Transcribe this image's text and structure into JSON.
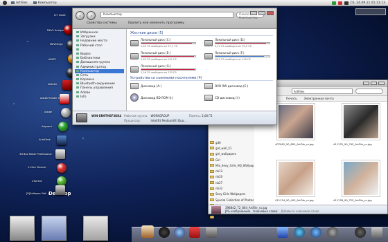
{
  "menubar": {
    "items": [
      "ArtFiles",
      "Компьютер"
    ],
    "clock": "Сб, 24.09.11 01:11:13"
  },
  "desktop_labels": [
    "ICT mode",
    "MKV1 Analyzer",
    "MKVMerge",
    "AIMP2",
    "AIDA64",
    "Adobe Reader X",
    "Adobe",
    "Adguard",
    "AutoDesk",
    "3D Box Maker Professional",
    "1-Click Cleaner",
    "uTorrent",
    "[R]Software Edit.",
    "Desktop"
  ],
  "computer_window": {
    "address": "Компьютер",
    "search_placeholder": "Поиск: Компьютер",
    "toolbar": [
      "Свойства системы",
      "Удалить или изменить программу"
    ],
    "nav": [
      {
        "label": "Избранное",
        "selected": false
      },
      {
        "label": "Загрузки",
        "selected": false
      },
      {
        "label": "Недавние места",
        "selected": false
      },
      {
        "label": "Рабочий стол",
        "selected": false
      },
      {
        "label": "",
        "selected": false
      },
      {
        "label": "Видео",
        "selected": false
      },
      {
        "label": "Библиотеки",
        "selected": false
      },
      {
        "label": "Домашняя группа",
        "selected": false
      },
      {
        "label": "Администратор",
        "selected": false
      },
      {
        "label": "Компьютер",
        "selected": true
      },
      {
        "label": "Сеть",
        "selected": false
      },
      {
        "label": "Корзина",
        "selected": false
      },
      {
        "label": "Bluetooth-окружение",
        "selected": false
      },
      {
        "label": "Панель управления",
        "selected": false
      },
      {
        "label": "Adobe",
        "selected": false
      },
      {
        "label": "Info",
        "selected": false
      }
    ],
    "hdd_section": "Жесткие диски (5)",
    "drives": [
      {
        "name": "Локальный диск (C:)",
        "free": "2,60 ГБ свободно из 37,1 ГБ",
        "fill": 0.93,
        "color": "red"
      },
      {
        "name": "Локальный диск (D:)",
        "free": "2,21 ГБ свободно из 39,0 ГБ",
        "fill": 0.94,
        "color": "red"
      },
      {
        "name": "Локальный диск (E:)",
        "free": "2,65 ГБ свободно из 191 ГБ",
        "fill": 0.98,
        "color": "red"
      },
      {
        "name": "Локальный диск (F:)",
        "free": "18,5 ГБ свободно из 195 ГБ",
        "fill": 0.9,
        "color": "blue"
      },
      {
        "name": "Локальный диск (G:)",
        "free": "2,56 ГБ свободно из 233 ГБ",
        "fill": 0.99,
        "color": "red"
      }
    ],
    "removable_section": "Устройства со съемными носителями (4)",
    "removables": [
      {
        "name": "Дисковод (A:)"
      },
      {
        "name": "DVD RW дисковод (E:)"
      },
      {
        "name": "Дисковод BD-ROM (I:)"
      },
      {
        "name": "CD-дисковод (I:)"
      }
    ],
    "details": {
      "pc_name": "WIN-EN9TH6F3KK4",
      "workgroup_label": "Рабочая группа:",
      "workgroup": "WORKGROUP",
      "memory_label": "Память:",
      "memory": "2,00 ГБ",
      "cpu_label": "Процессор:",
      "cpu": "Intel(R) Pentium(R) Dua..."
    }
  },
  "artfiles_window": {
    "address": "ArtFiles",
    "toolbar": [
      "Печать",
      "Электронная почта"
    ],
    "folders": [
      "g40",
      "girl_wall_51",
      "girl_wallpapers",
      "Girl",
      "Mix_Sexy_Girls_HQ_Wallpapers",
      "nb12",
      "nb20",
      "nb27",
      "nb32",
      "Sexy Girls Wallpapers",
      "Special Collection of Photos",
      "Wallpapers",
      "64mpx",
      "girls1"
    ],
    "thumbs": [
      {
        "label": "407962_90_855_ArtFile_ru.jpg"
      },
      {
        "label": "411132_90_745_ArtFile_ru.jpg"
      },
      {
        "label": "411134_90_493_ArtFile_ru.jpg"
      },
      {
        "label": "411138_90_725_ArtFile_ru.jpg"
      }
    ],
    "status_name": "398842_72_864_ArtFile_ru.jpg",
    "status_sub": "JPG изображение",
    "status_keywords_label": "Ключевые слова:",
    "status_keywords": "Добавьте ключевое слово"
  },
  "colors": {
    "selection": "#3a76d4",
    "drive_bar_red": "#cc2244",
    "drive_bar_blue": "#3a7ad8"
  }
}
